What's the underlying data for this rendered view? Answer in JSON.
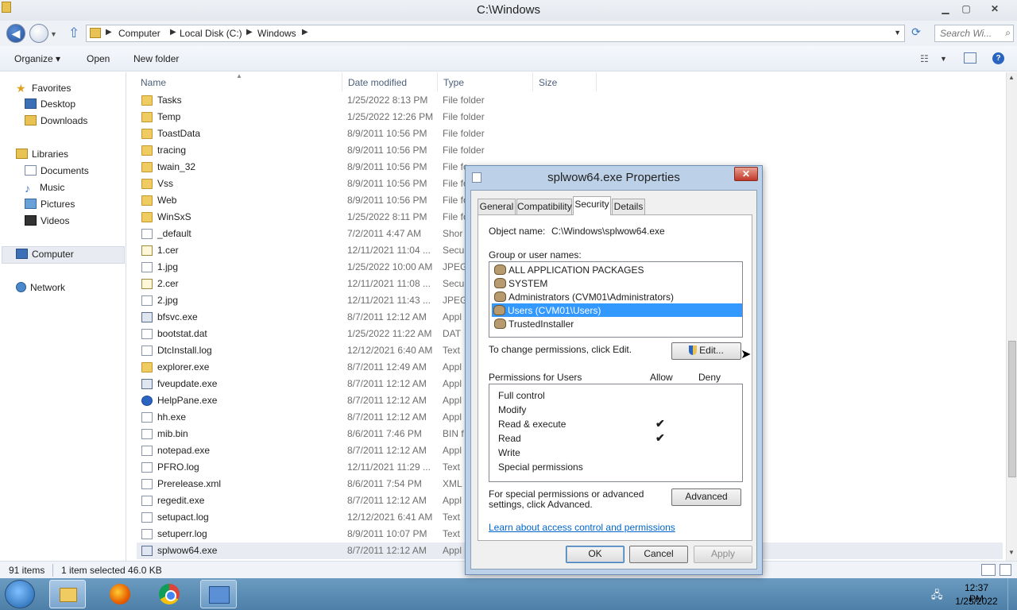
{
  "window": {
    "title": "C:\\Windows",
    "minimize": "▁",
    "maximize": "▢",
    "close": "✕"
  },
  "address": {
    "crumbs": [
      "Computer",
      "Local Disk (C:)",
      "Windows"
    ],
    "search_placeholder": "Search Wi..."
  },
  "toolbar": {
    "organize": "Organize ▾",
    "open": "Open",
    "new_folder": "New folder"
  },
  "nav": {
    "favorites": "Favorites",
    "desktop": "Desktop",
    "downloads": "Downloads",
    "libraries": "Libraries",
    "documents": "Documents",
    "music": "Music",
    "pictures": "Pictures",
    "videos": "Videos",
    "computer": "Computer",
    "network": "Network"
  },
  "columns": {
    "name": "Name",
    "date": "Date modified",
    "type": "Type",
    "size": "Size"
  },
  "files": [
    {
      "name": "Tasks",
      "date": "1/25/2022 8:13 PM",
      "type": "File folder",
      "icon": "folder-icon"
    },
    {
      "name": "Temp",
      "date": "1/25/2022 12:26 PM",
      "type": "File folder",
      "icon": "folder-icon"
    },
    {
      "name": "ToastData",
      "date": "8/9/2011 10:56 PM",
      "type": "File folder",
      "icon": "folder-icon"
    },
    {
      "name": "tracing",
      "date": "8/9/2011 10:56 PM",
      "type": "File folder",
      "icon": "folder-icon"
    },
    {
      "name": "twain_32",
      "date": "8/9/2011 10:56 PM",
      "type": "File fo",
      "icon": "folder-icon"
    },
    {
      "name": "Vss",
      "date": "8/9/2011 10:56 PM",
      "type": "File fo",
      "icon": "folder-icon"
    },
    {
      "name": "Web",
      "date": "8/9/2011 10:56 PM",
      "type": "File fo",
      "icon": "folder-icon"
    },
    {
      "name": "WinSxS",
      "date": "1/25/2022 8:11 PM",
      "type": "File fo",
      "icon": "folder-icon"
    },
    {
      "name": "_default",
      "date": "7/2/2011 4:47 AM",
      "type": "Shor",
      "icon": "shortcut-icon"
    },
    {
      "name": "1.cer",
      "date": "12/11/2021 11:04 ...",
      "type": "Secu",
      "icon": "certificate-icon"
    },
    {
      "name": "1.jpg",
      "date": "1/25/2022 10:00 AM",
      "type": "JPEG",
      "icon": "image-icon"
    },
    {
      "name": "2.cer",
      "date": "12/11/2021 11:08 ...",
      "type": "Secu",
      "icon": "certificate-icon"
    },
    {
      "name": "2.jpg",
      "date": "12/11/2021 11:43 ...",
      "type": "JPEG",
      "icon": "image-icon"
    },
    {
      "name": "bfsvc.exe",
      "date": "8/7/2011 12:12 AM",
      "type": "Appl",
      "icon": "exe-icon"
    },
    {
      "name": "bootstat.dat",
      "date": "1/25/2022 11:22 AM",
      "type": "DAT",
      "icon": "file-icon"
    },
    {
      "name": "DtcInstall.log",
      "date": "12/12/2021 6:40 AM",
      "type": "Text",
      "icon": "text-file-icon"
    },
    {
      "name": "explorer.exe",
      "date": "8/7/2011 12:49 AM",
      "type": "Appl",
      "icon": "folder-icon"
    },
    {
      "name": "fveupdate.exe",
      "date": "8/7/2011 12:12 AM",
      "type": "Appl",
      "icon": "exe-icon"
    },
    {
      "name": "HelpPane.exe",
      "date": "8/7/2011 12:12 AM",
      "type": "Appl",
      "icon": "help-icon"
    },
    {
      "name": "hh.exe",
      "date": "8/7/2011 12:12 AM",
      "type": "Appl",
      "icon": "help-file-icon"
    },
    {
      "name": "mib.bin",
      "date": "8/6/2011 7:46 PM",
      "type": "BIN f",
      "icon": "file-icon"
    },
    {
      "name": "notepad.exe",
      "date": "8/7/2011 12:12 AM",
      "type": "Appl",
      "icon": "notepad-icon"
    },
    {
      "name": "PFRO.log",
      "date": "12/11/2021 11:29 ...",
      "type": "Text",
      "icon": "text-file-icon"
    },
    {
      "name": "Prerelease.xml",
      "date": "8/6/2011 7:54 PM",
      "type": "XML",
      "icon": "xml-file-icon"
    },
    {
      "name": "regedit.exe",
      "date": "8/7/2011 12:12 AM",
      "type": "Appl",
      "icon": "regedit-icon"
    },
    {
      "name": "setupact.log",
      "date": "12/12/2021 6:41 AM",
      "type": "Text",
      "icon": "text-file-icon"
    },
    {
      "name": "setuperr.log",
      "date": "8/9/2011 10:07 PM",
      "type": "Text",
      "icon": "text-file-icon"
    },
    {
      "name": "splwow64.exe",
      "date": "8/7/2011 12:12 AM",
      "type": "Appl",
      "icon": "exe-icon",
      "selected": true
    }
  ],
  "status": {
    "count": "91 items",
    "selection": "1 item selected  46.0 KB"
  },
  "taskbar": {
    "time": "12:37 PM",
    "date": "1/25/2022"
  },
  "dialog": {
    "title": "splwow64.exe Properties",
    "close": "✕",
    "tabs": [
      "General",
      "Compatibility",
      "Security",
      "Details"
    ],
    "active_tab": "Security",
    "object_name_label": "Object name:",
    "object_name_value": "C:\\Windows\\splwow64.exe",
    "group_label": "Group or user names:",
    "groups": [
      {
        "name": "ALL APPLICATION PACKAGES"
      },
      {
        "name": "SYSTEM"
      },
      {
        "name": "Administrators (CVM01\\Administrators)"
      },
      {
        "name": "Users (CVM01\\Users)",
        "selected": true
      },
      {
        "name": "TrustedInstaller"
      }
    ],
    "change_label": "To change permissions, click Edit.",
    "edit_button": "Edit...",
    "permissions_label": "Permissions for Users",
    "allow_header": "Allow",
    "deny_header": "Deny",
    "permissions": [
      {
        "name": "Full control",
        "allow": ""
      },
      {
        "name": "Modify",
        "allow": ""
      },
      {
        "name": "Read & execute",
        "allow": "✔"
      },
      {
        "name": "Read",
        "allow": "✔"
      },
      {
        "name": "Write",
        "allow": ""
      },
      {
        "name": "Special permissions",
        "allow": ""
      }
    ],
    "special_label": "For special permissions or advanced settings, click Advanced.",
    "advanced_button": "Advanced",
    "learn_link": "Learn about access control and permissions",
    "ok": "OK",
    "cancel": "Cancel",
    "apply": "Apply"
  }
}
